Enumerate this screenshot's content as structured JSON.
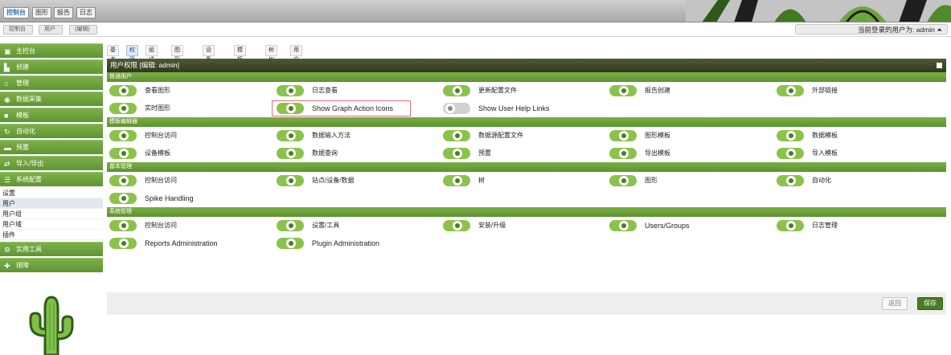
{
  "top_tabs": [
    {
      "label": "控制台",
      "active": true
    },
    {
      "label": "图形",
      "active": false
    },
    {
      "label": "报告",
      "active": false
    },
    {
      "label": "日志",
      "active": false
    }
  ],
  "breadcrumbs": [
    "控制台",
    "用户",
    "(编辑)"
  ],
  "user_info": "当前登录的用户为: admin",
  "sidebar": {
    "menu_top": [
      {
        "label": "主控台",
        "icon": "dashboard-icon"
      },
      {
        "label": "创建",
        "icon": "chart-icon"
      },
      {
        "label": "管理",
        "icon": "home-icon"
      },
      {
        "label": "数据采集",
        "icon": "database-icon"
      },
      {
        "label": "模板",
        "icon": "template-icon"
      },
      {
        "label": "自动化",
        "icon": "automation-icon"
      },
      {
        "label": "预置",
        "icon": "preset-icon"
      },
      {
        "label": "导入/导出",
        "icon": "import-export-icon"
      },
      {
        "label": "系统配置",
        "icon": "config-icon"
      }
    ],
    "sub_items": [
      {
        "label": "设置",
        "active": false
      },
      {
        "label": "用户",
        "active": true
      },
      {
        "label": "用户组",
        "active": false
      },
      {
        "label": "用户域",
        "active": false
      },
      {
        "label": "插件",
        "active": false
      }
    ],
    "menu_bottom": [
      {
        "label": "实用工具",
        "icon": "tools-icon"
      },
      {
        "label": "排障",
        "icon": "troubleshoot-icon"
      }
    ]
  },
  "page_tabs": [
    {
      "label": "基本",
      "active": false
    },
    {
      "label": "权限",
      "active": true
    },
    {
      "label": "组成员",
      "active": false
    },
    {
      "label": "图形权限",
      "active": false
    },
    {
      "label": "设备权限",
      "active": false
    },
    {
      "label": "模板权限",
      "active": false
    },
    {
      "label": "树权限",
      "active": false
    },
    {
      "label": "用户设置",
      "active": false
    }
  ],
  "panel_title": "用户权限 [编辑: admin]",
  "sections": [
    {
      "title": "普通用户",
      "rows": [
        [
          {
            "label": "查看图形",
            "on": true
          },
          {
            "label": "日志查看",
            "on": true
          },
          {
            "label": "更新配置文件",
            "on": true
          },
          {
            "label": "报告创建",
            "on": true
          },
          {
            "label": "外部链接",
            "on": true
          }
        ],
        [
          {
            "label": "实时图形",
            "on": true
          },
          {
            "label": "Show Graph Action Icons",
            "on": true
          },
          {
            "label": "Show User Help Links",
            "on": false
          }
        ]
      ]
    },
    {
      "title": "模板编辑器",
      "rows": [
        [
          {
            "label": "控制台访问",
            "on": true
          },
          {
            "label": "数据输入方法",
            "on": true
          },
          {
            "label": "数据源配置文件",
            "on": true
          },
          {
            "label": "图形模板",
            "on": true
          },
          {
            "label": "数据模板",
            "on": true
          }
        ],
        [
          {
            "label": "设备模板",
            "on": true
          },
          {
            "label": "数据查询",
            "on": true
          },
          {
            "label": "预置",
            "on": true
          },
          {
            "label": "导出模板",
            "on": true
          },
          {
            "label": "导入模板",
            "on": true
          }
        ]
      ]
    },
    {
      "title": "基本管理",
      "rows": [
        [
          {
            "label": "控制台访问",
            "on": true
          },
          {
            "label": "站点/设备/数据",
            "on": true
          },
          {
            "label": "树",
            "on": true
          },
          {
            "label": "图形",
            "on": true
          },
          {
            "label": "自动化",
            "on": true
          }
        ],
        [
          {
            "label": "Spike Handling",
            "on": true
          }
        ]
      ]
    },
    {
      "title": "系统管理",
      "rows": [
        [
          {
            "label": "控制台访问",
            "on": true
          },
          {
            "label": "设置/工具",
            "on": true
          },
          {
            "label": "安装/升级",
            "on": true
          },
          {
            "label": "Users/Groups",
            "on": true
          },
          {
            "label": "日志管理",
            "on": true
          }
        ],
        [
          {
            "label": "Reports Administration",
            "on": true
          },
          {
            "label": "Plugin Administration",
            "on": true
          }
        ]
      ]
    }
  ],
  "buttons": {
    "back": "返回",
    "save": "保存"
  },
  "colors": {
    "accent_green": "#6da33d",
    "header_dark": "#3b4726",
    "toggle_on": "#8bc34a",
    "toggle_off": "#d0d0d0"
  }
}
